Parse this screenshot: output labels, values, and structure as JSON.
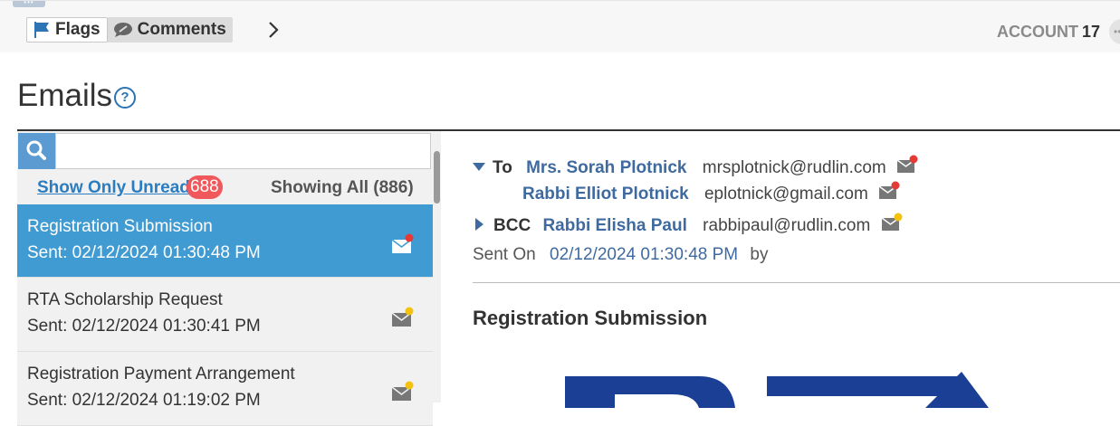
{
  "toolbar": {
    "tabs": [
      {
        "label": "Flags",
        "icon": "flag-icon"
      },
      {
        "label": "Comments",
        "icon": "comment-icon"
      }
    ],
    "account_label": "ACCOUNT",
    "account_number": "17"
  },
  "page": {
    "title": "Emails",
    "help_glyph": "?"
  },
  "list_header": {
    "show_only_unread": "Show Only Unread",
    "unread_count": "688",
    "showing_all": "Showing All (886)"
  },
  "emails": [
    {
      "subject": "Registration Submission",
      "sent": "Sent: 02/12/2024 01:30:48 PM",
      "status": "unread",
      "dot_color": "#e53935"
    },
    {
      "subject": "RTA Scholarship Request",
      "sent": "Sent: 02/12/2024 01:30:41 PM",
      "status": "read",
      "dot_color": "#f4c20d"
    },
    {
      "subject": "Registration Payment Arrangement",
      "sent": "Sent: 02/12/2024 01:19:02 PM",
      "status": "read",
      "dot_color": "#f4c20d"
    }
  ],
  "detail": {
    "to_label": "To",
    "recipients": [
      {
        "name": "Mrs. Sorah Plotnick",
        "email": "mrsplotnick@rudlin.com",
        "dot_color": "#e53935"
      },
      {
        "name": "Rabbi Elliot Plotnick",
        "email": "eplotnick@gmail.com",
        "dot_color": "#e53935"
      }
    ],
    "bcc_label": "BCC",
    "bcc": {
      "name": "Rabbi Elisha Paul",
      "email": "rabbipaul@rudlin.com",
      "dot_color": "#f4c20d"
    },
    "sent_on_label": "Sent On",
    "sent_on": "02/12/2024 01:30:48 PM",
    "by_label": "by",
    "subject": "Registration Submission"
  },
  "colors": {
    "accent": "#419bd3",
    "link": "#2c7cc0",
    "badge": "#f0585b",
    "person": "#3f6aa0",
    "logo": "#1b3f94"
  }
}
